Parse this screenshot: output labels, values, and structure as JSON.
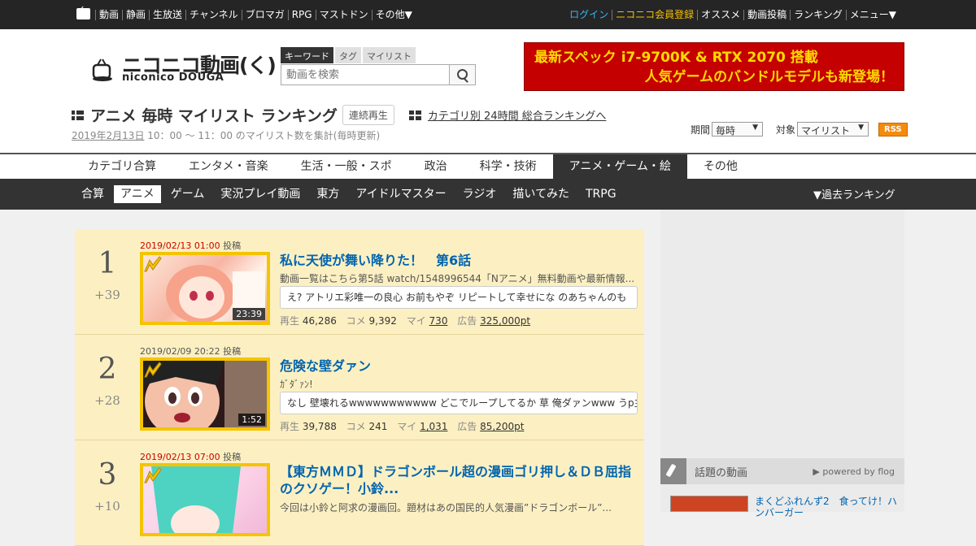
{
  "gnav": {
    "left": [
      "動画",
      "静画",
      "生放送",
      "チャンネル",
      "ブロマガ",
      "RPG",
      "マストドン",
      "その他▼"
    ],
    "right": {
      "login": "ログイン",
      "premium": "ニコニコ会員登録",
      "items": [
        "オススメ",
        "動画投稿",
        "ランキング",
        "メニュー▼"
      ]
    }
  },
  "logo": {
    "jp": "ニコニコ動画(く)",
    "en": "niconico DOUGA"
  },
  "search": {
    "tabs": [
      "キーワード",
      "タグ",
      "マイリスト"
    ],
    "placeholder": "動画を検索"
  },
  "ad": {
    "line1": "最新スペック i7-9700K & RTX 2070 搭載",
    "line2": "人気ゲームのバンドルモデルも新登場！"
  },
  "ranking": {
    "title": "アニメ 毎時 マイリスト ランキング",
    "continuous": "連続再生",
    "category_link": "カテゴリ別 24時間 総合ランキングへ",
    "date": "2019年2月13日",
    "range": " 10：00 ～ 11：00 のマイリスト数を集計(毎時更新)",
    "period_label": "期間",
    "period_value": "毎時",
    "target_label": "対象",
    "target_value": "マイリスト",
    "rss": "RSS"
  },
  "categories": [
    "カテゴリ合算",
    "エンタメ・音楽",
    "生活・一般・スポ",
    "政治",
    "科学・技術",
    "アニメ・ゲーム・絵",
    "その他"
  ],
  "subcategories": [
    "合算",
    "アニメ",
    "ゲーム",
    "実況プレイ動画",
    "東方",
    "アイドルマスター",
    "ラジオ",
    "描いてみた",
    "TRPG"
  ],
  "past_ranking": "▼過去ランキング",
  "items": [
    {
      "rank": "1",
      "delta": "+39",
      "posted": "2019/02/13 01:00",
      "posted_suffix": " 投稿",
      "duration": "23:39",
      "title": "私に天使が舞い降りた！　第6話",
      "desc": "動画一覧はこちら第5話 watch/1548996544「Nアニメ」無料動画や最新情報...",
      "comment": "え? アトリエ彩唯一の良心 お前もやぞ リピートして幸せにな のあちゃんのも",
      "views": "46,286",
      "comments": "9,392",
      "mylists": "730",
      "ads": "325,000pt",
      "color": "#f6b8a8"
    },
    {
      "rank": "2",
      "delta": "+28",
      "posted": "2019/02/09 20:22",
      "posted_suffix": " 投稿",
      "duration": "1:52",
      "title": "危険な壁ダァン",
      "desc": "ｶﾞﾀﾞｧﾝ!",
      "comment": "なし 壁壊れるwwwwwwwwwww どこでループしてるか 草 俺ダァンwww うp主",
      "views": "39,788",
      "comments": "241",
      "mylists": "1,031",
      "ads": "85,200pt",
      "color": "#5a3a3a"
    },
    {
      "rank": "3",
      "delta": "+10",
      "posted": "2019/02/13 07:00",
      "posted_suffix": " 投稿",
      "duration": "",
      "title": "【東方ＭＭＤ】ドラゴンボール超の漫画ゴリ押し＆ＤＢ屈指のクソゲー！小鈴...",
      "desc": "今回は小鈴と阿求の漫画回。題材はあの国民的人気漫画”ドラゴンボール”...",
      "comment": "",
      "views": "",
      "comments": "",
      "mylists": "",
      "ads": "",
      "color": "#5ad0c0"
    }
  ],
  "stat_labels": {
    "views": "再生",
    "comments": "コメ",
    "mylists": "マイ",
    "ads": "広告"
  },
  "sidebar": {
    "title": "話題の動画",
    "powered": "▶ powered by flog",
    "topic": "まくどふれんず2　食ってけ！ハンバーガー"
  }
}
